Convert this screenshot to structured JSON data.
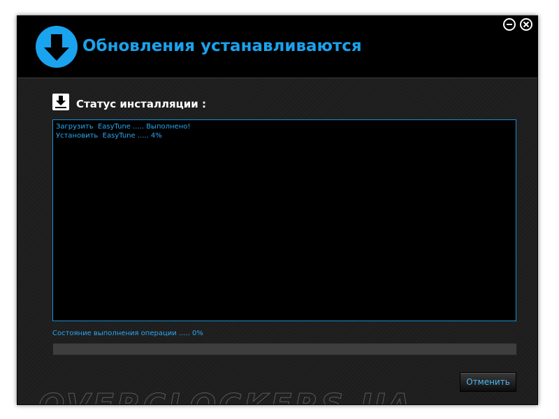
{
  "window": {
    "title": "Обновления устанавливаются",
    "header_icon": "download-arrow-icon",
    "controls": {
      "minimize_icon": "minimize-icon",
      "close_icon": "close-icon"
    },
    "accent_color": "#1aa3ee"
  },
  "status": {
    "icon": "download-icon",
    "label": "Статус инсталляции :"
  },
  "log": {
    "lines": [
      "Загрузить  EasyTune ..... Выполнено!",
      "Установить  EasyTune ..... 4%"
    ]
  },
  "progress": {
    "label": "Состояние выполнения операции ..... 0%",
    "percent": 0
  },
  "buttons": {
    "cancel_label": "Отменить"
  },
  "watermark": "OVERCLOCKERS.UA"
}
